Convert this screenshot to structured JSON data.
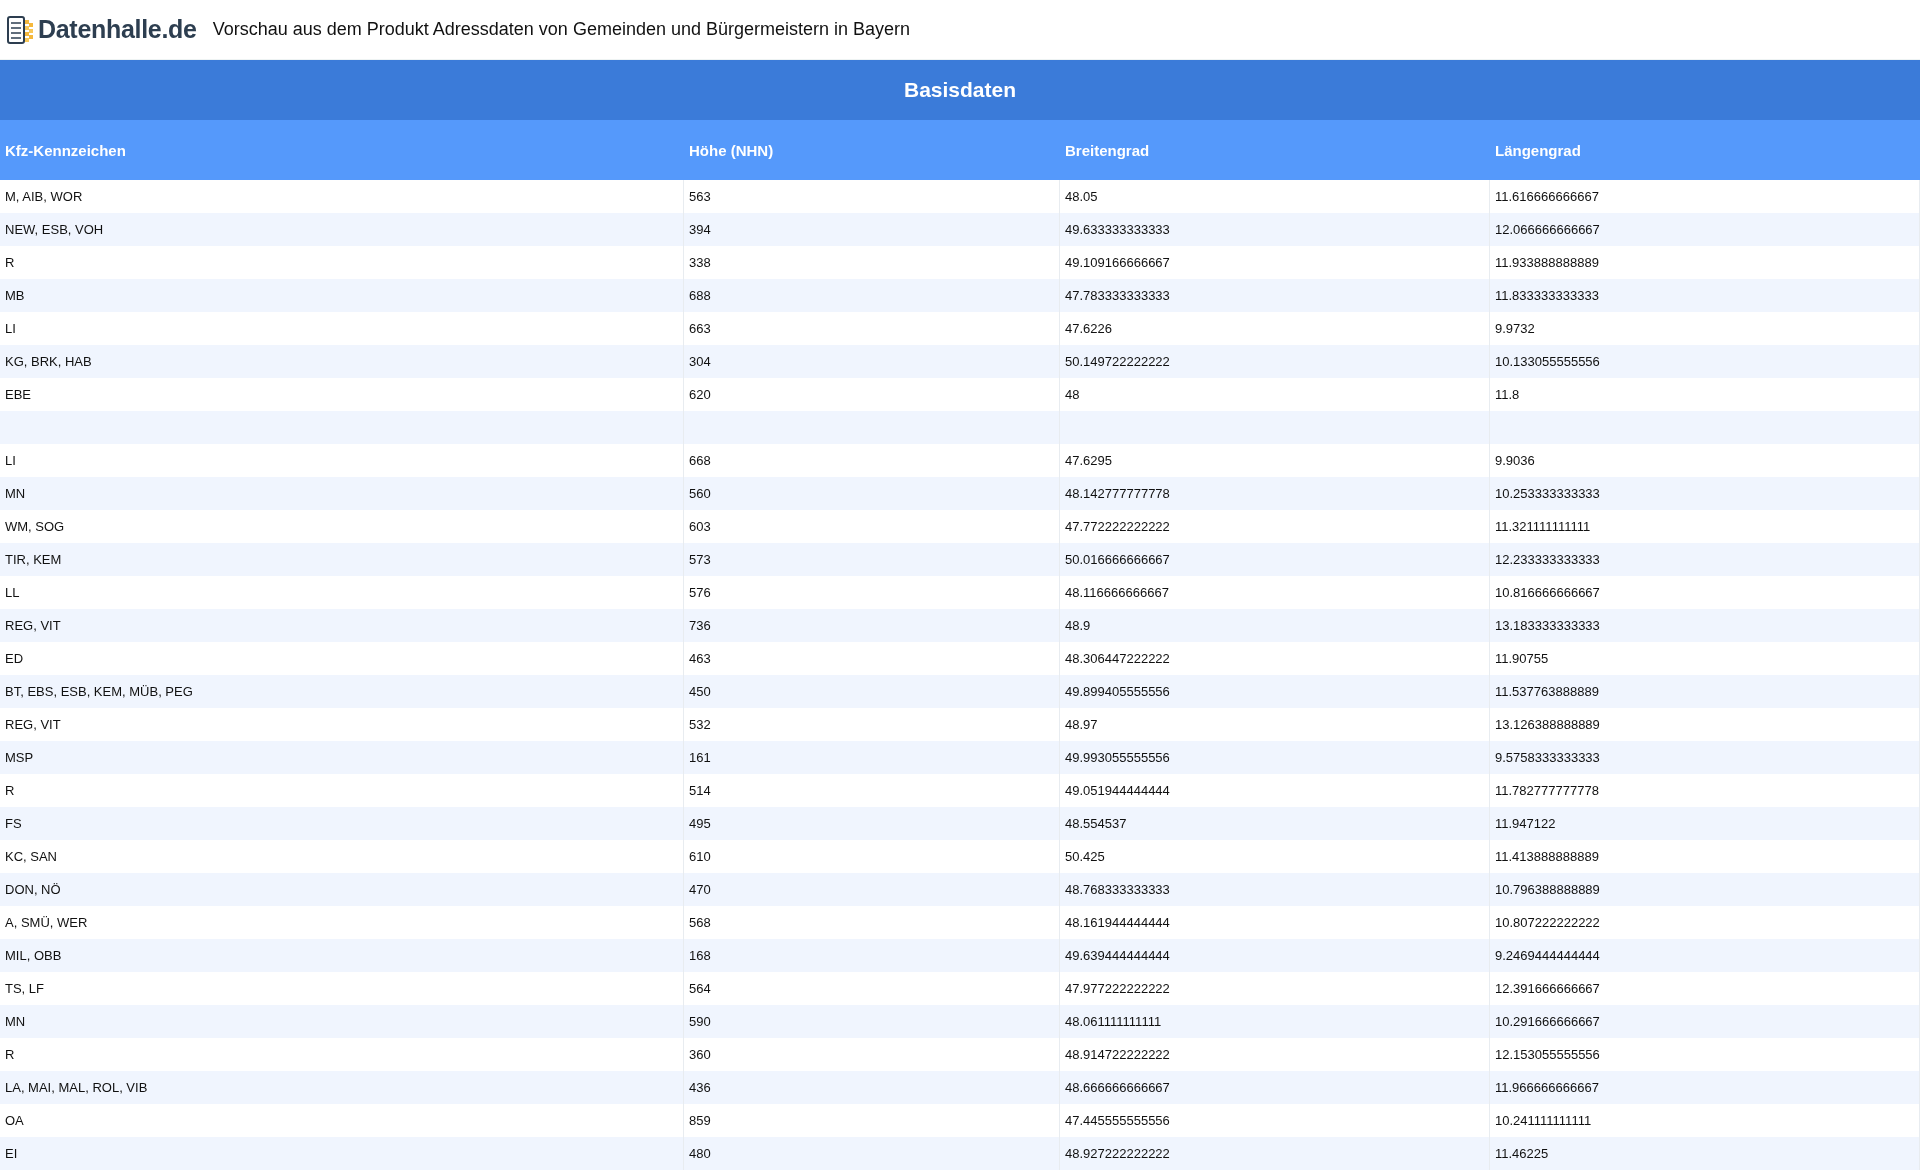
{
  "header": {
    "logo_text": "Datenhalle.de",
    "title": "Vorschau aus dem Produkt Adressdaten von Gemeinden und Bürgermeistern in Bayern"
  },
  "table": {
    "section_title": "Basisdaten",
    "columns": [
      "Kfz-Kennzeichen",
      "Höhe (NHN)",
      "Breitengrad",
      "Längengrad"
    ],
    "rows": [
      {
        "cells": [
          "M, AIB, WOR",
          "563",
          "48.05",
          "11.616666666667"
        ]
      },
      {
        "cells": [
          "NEW, ESB, VOH",
          "394",
          "49.633333333333",
          "12.066666666667"
        ]
      },
      {
        "cells": [
          "R",
          "338",
          "49.109166666667",
          "11.933888888889"
        ]
      },
      {
        "cells": [
          "MB",
          "688",
          "47.783333333333",
          "11.833333333333"
        ]
      },
      {
        "cells": [
          "LI",
          "663",
          "47.6226",
          "9.9732"
        ]
      },
      {
        "cells": [
          "KG, BRK, HAB",
          "304",
          "50.149722222222",
          "10.133055555556"
        ]
      },
      {
        "cells": [
          "EBE",
          "620",
          "48",
          "11.8"
        ]
      },
      {
        "cells": []
      },
      {
        "cells": [
          "LI",
          "668",
          "47.6295",
          "9.9036"
        ]
      },
      {
        "cells": [
          "MN",
          "560",
          "48.142777777778",
          "10.253333333333"
        ]
      },
      {
        "cells": [
          "WM, SOG",
          "603",
          "47.772222222222",
          "11.321111111111"
        ]
      },
      {
        "cells": [
          "TIR, KEM",
          "573",
          "50.016666666667",
          "12.233333333333"
        ]
      },
      {
        "cells": [
          "LL",
          "576",
          "48.116666666667",
          "10.816666666667"
        ]
      },
      {
        "cells": [
          "REG, VIT",
          "736",
          "48.9",
          "13.183333333333"
        ]
      },
      {
        "cells": [
          "ED",
          "463",
          "48.306447222222",
          "11.90755"
        ]
      },
      {
        "cells": [
          "BT, EBS, ESB, KEM, MÜB, PEG",
          "450",
          "49.899405555556",
          "11.537763888889"
        ]
      },
      {
        "cells": [
          "REG, VIT",
          "532",
          "48.97",
          "13.126388888889"
        ]
      },
      {
        "cells": [
          "MSP",
          "161",
          "49.993055555556",
          "9.5758333333333"
        ]
      },
      {
        "cells": [
          "R",
          "514",
          "49.051944444444",
          "11.782777777778"
        ]
      },
      {
        "cells": [
          "FS",
          "495",
          "48.554537",
          "11.947122"
        ]
      },
      {
        "cells": [
          "KC, SAN",
          "610",
          "50.425",
          "11.413888888889"
        ]
      },
      {
        "cells": [
          "DON, NÖ",
          "470",
          "48.768333333333",
          "10.796388888889"
        ]
      },
      {
        "cells": [
          "A, SMÜ, WER",
          "568",
          "48.161944444444",
          "10.807222222222"
        ]
      },
      {
        "cells": [
          "MIL, OBB",
          "168",
          "49.639444444444",
          "9.2469444444444"
        ]
      },
      {
        "cells": [
          "TS, LF",
          "564",
          "47.977222222222",
          "12.391666666667"
        ]
      },
      {
        "cells": [
          "MN",
          "590",
          "48.061111111111",
          "10.291666666667"
        ]
      },
      {
        "cells": [
          "R",
          "360",
          "48.914722222222",
          "12.153055555556"
        ]
      },
      {
        "cells": [
          "LA, MAI, MAL, ROL, VIB",
          "436",
          "48.666666666667",
          "11.966666666667"
        ]
      },
      {
        "cells": [
          "OA",
          "859",
          "47.445555555556",
          "10.241111111111"
        ]
      },
      {
        "cells": [
          "EI",
          "480",
          "48.927222222222",
          "11.46225"
        ]
      }
    ]
  }
}
